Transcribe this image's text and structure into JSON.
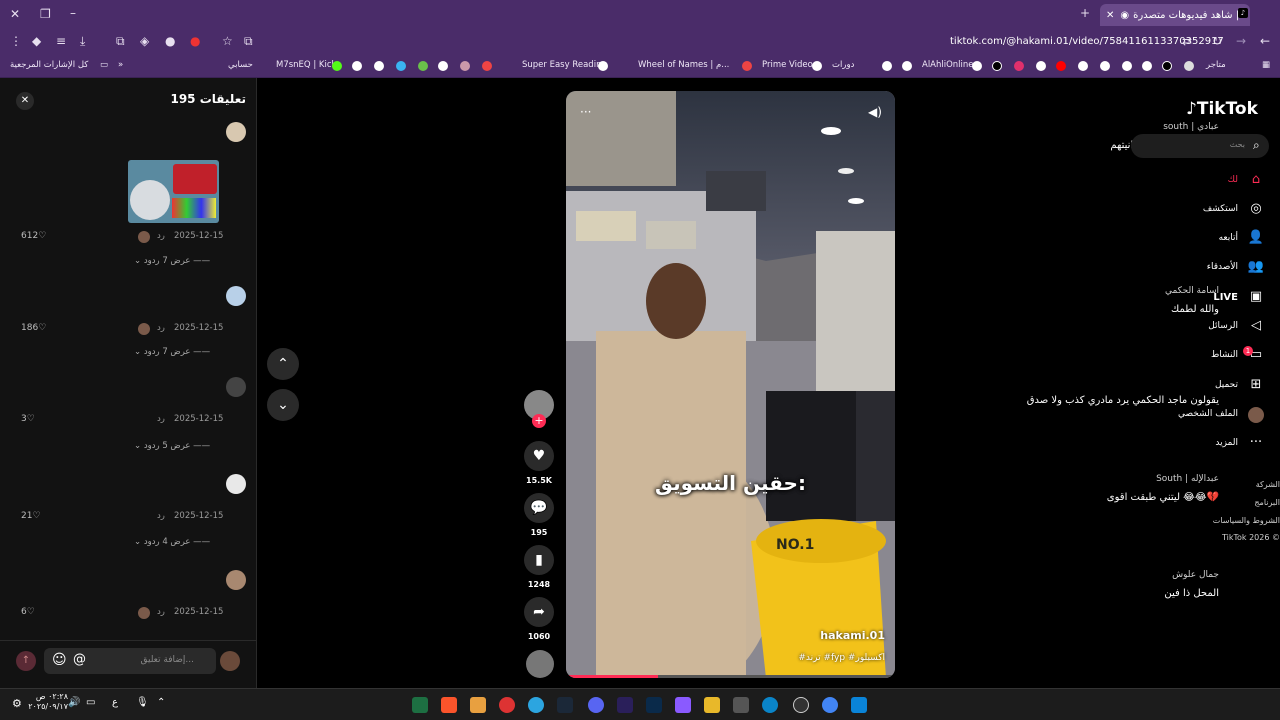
{
  "browser": {
    "tab_title": "شاهد فيديوهات متصدرة | ...",
    "url": "tiktok.com/@hakami.01/video/7584116113370352917",
    "bookmarks": [
      "متاجر",
      "AlAhliOnline",
      "دورات",
      "Prime Video",
      "Wheel of Names | م...",
      "Super Easy Reading",
      "M7snEQ | Kick",
      "حسابي",
      "كل الإشارات المرجعية"
    ]
  },
  "comments": {
    "title": "تعليقات 195",
    "items": [
      {
        "name": "south | عبادي",
        "text": "العده الي تناسب ميزانيتهم",
        "date": "2025-12-15",
        "reply": "رد",
        "likes": "612",
        "replies": "عرض 7 ردود"
      },
      {
        "name": "اسامة الحكمي",
        "text": "والله لطمك",
        "date": "2025-12-15",
        "reply": "رد",
        "likes": "186",
        "replies": "عرض 7 ردود"
      },
      {
        "name": "",
        "text": "يقولون ماجد الحكمي يرد مادري كذب ولا صدق",
        "date": "2025-12-15",
        "reply": "رد",
        "likes": "3",
        "replies": "عرض 5 ردود"
      },
      {
        "name": "South | عبدالإله",
        "text": "ليتني طبقت اقوى 😂😂💔",
        "date": "2025-12-15",
        "reply": "رد",
        "likes": "21",
        "replies": "عرض 4 ردود"
      },
      {
        "name": "جمال علوش",
        "text": "المحل ذا فين",
        "date": "2025-12-15",
        "reply": "رد",
        "likes": "6",
        "replies": ""
      }
    ],
    "input_placeholder": "إضافة تعليق..."
  },
  "video": {
    "caption": "حقين التسويق:",
    "username": "hakami.01",
    "hashtags": "#ترند #fyp #اكسبلور"
  },
  "actions": {
    "likes": "15.5K",
    "comments": "195",
    "saves": "1248",
    "shares": "1060"
  },
  "sidebar": {
    "logo": "TikTok",
    "search_placeholder": "بحث",
    "items": [
      "لك",
      "استكشف",
      "أتابعه",
      "الأصدقاء",
      "LIVE",
      "الرسائل",
      "النشاط",
      "تحميل",
      "الملف الشخصي",
      "المزيد"
    ],
    "footer": [
      "الشركة",
      "البرنامج",
      "الشروط والسياسات",
      "TikTok 2026 ©"
    ],
    "activity_badge": "1"
  },
  "taskbar": {
    "time": "٠٢:٢٨ ص",
    "date": "٢٠٢٥/٠٩/١٧",
    "lang": "ع"
  },
  "colors": {
    "tiktok_red": "#fe2c55",
    "chrome_purple": "#4a2c69"
  }
}
